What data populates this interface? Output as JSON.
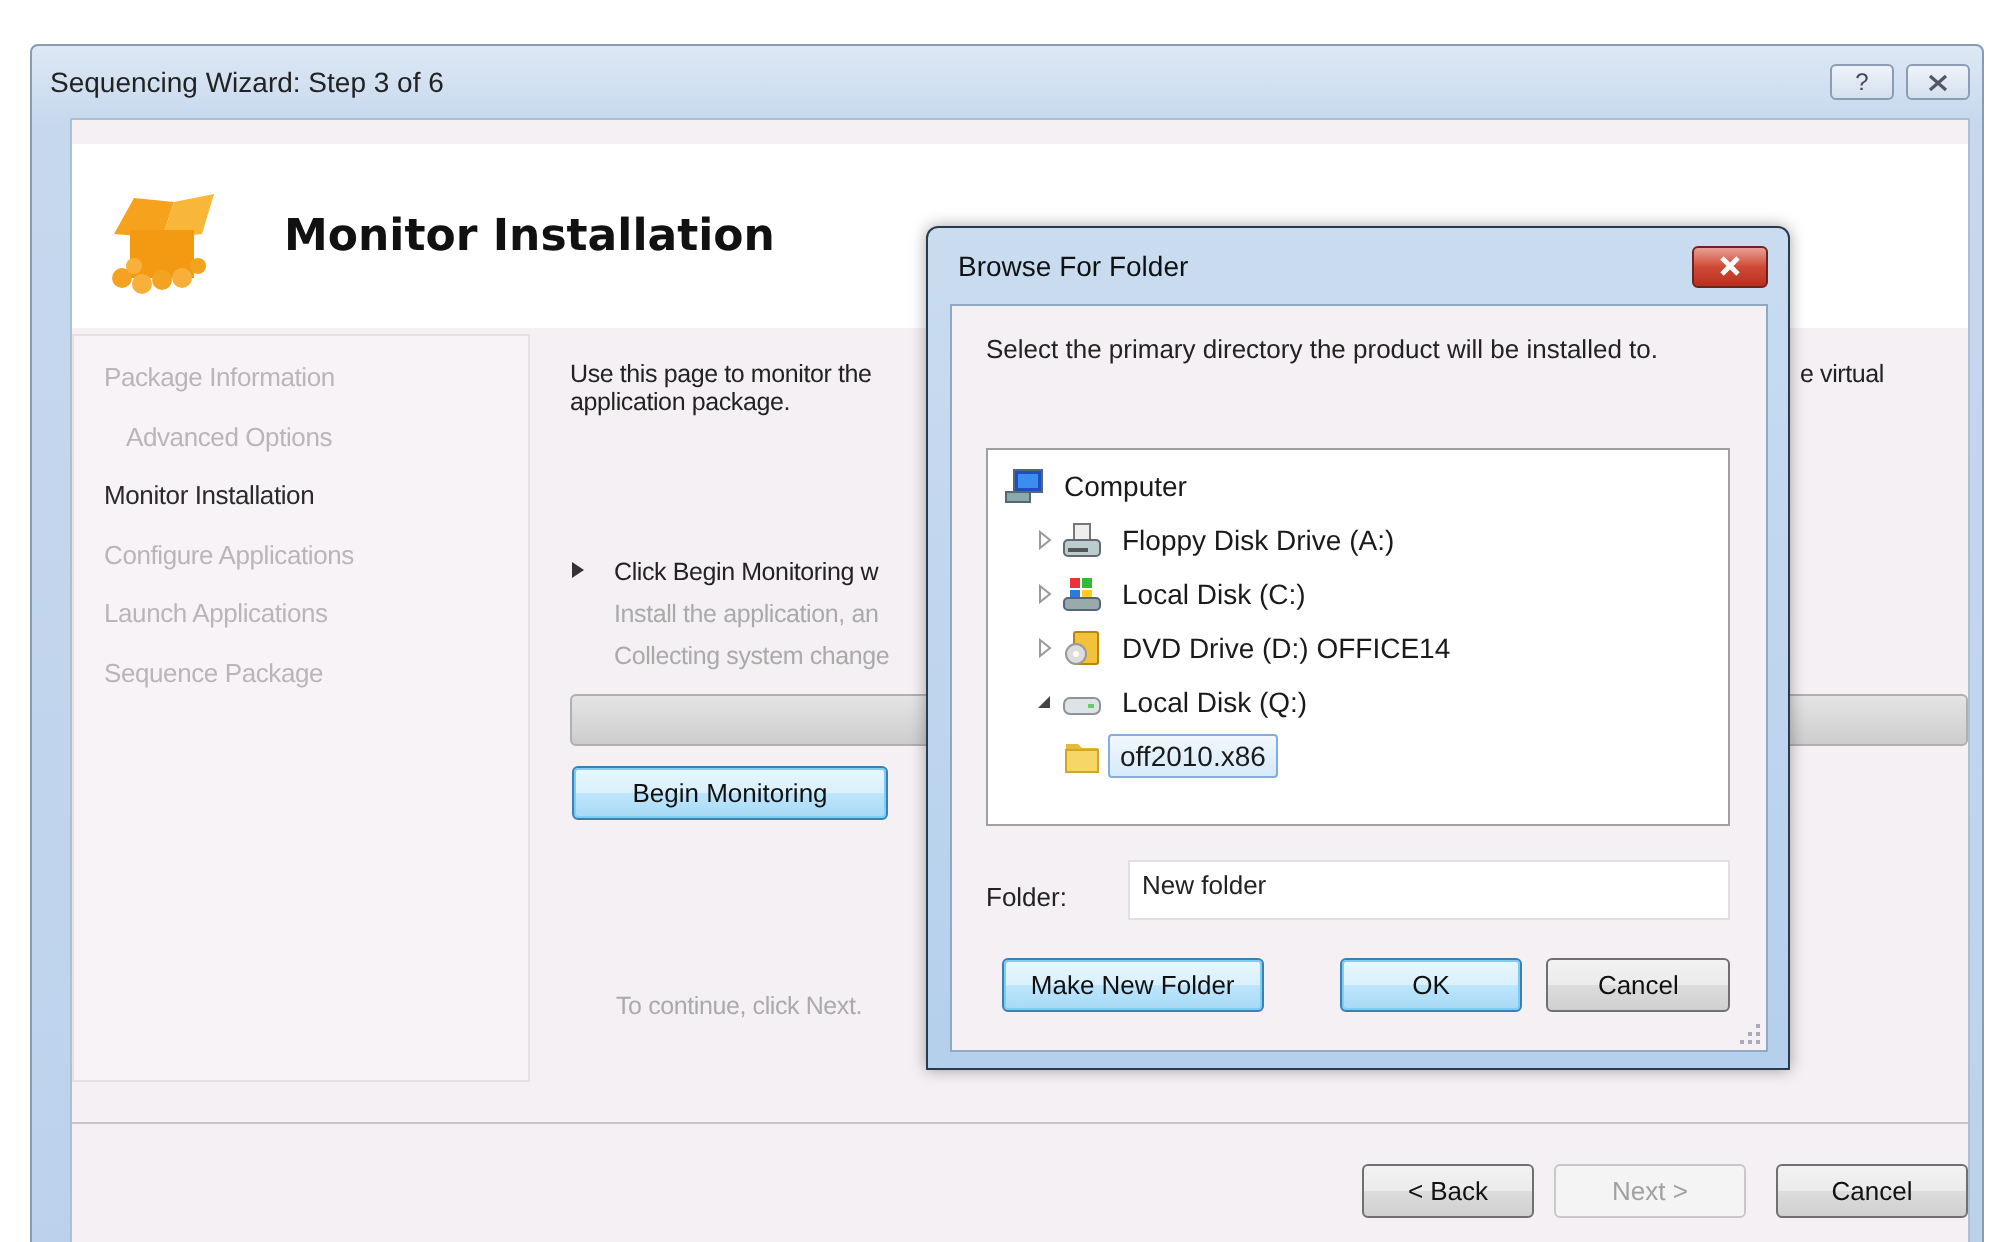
{
  "window": {
    "title": "Sequencing Wizard: Step 3 of 6",
    "help_button": "?"
  },
  "header": {
    "title": "Monitor Installation"
  },
  "sidebar": {
    "items": [
      {
        "label": "Package Information",
        "selected": false,
        "children": [
          {
            "label": "Advanced Options",
            "selected": false
          }
        ]
      },
      {
        "label": "Monitor Installation",
        "selected": true
      },
      {
        "label": "Configure Applications",
        "selected": false
      },
      {
        "label": "Launch Applications",
        "selected": false
      },
      {
        "label": "Sequence Package",
        "selected": false
      }
    ]
  },
  "main": {
    "intro_left": "Use this page to monitor the",
    "intro_right": "e virtual",
    "intro_line2": "application package.",
    "step": {
      "title": "Click Begin Monitoring w",
      "lines": [
        "Install the application, an",
        "Collecting system change"
      ]
    },
    "progress": {
      "level": 0
    },
    "begin_button": {
      "label": "Begin Monitoring",
      "focused": true
    },
    "continue_text": "To continue, click Next."
  },
  "nav_buttons": [
    {
      "label": "< Back",
      "disabled": false
    },
    {
      "label": "Next >",
      "disabled": true
    },
    {
      "label": "Cancel",
      "disabled": false
    }
  ],
  "dialog": {
    "title": "Browse For Folder",
    "prompt": "Select the primary directory the product will be installed to.",
    "tree": [
      {
        "label": "Computer",
        "kind": "computer",
        "selected": false,
        "children": [
          {
            "label": "Floppy Disk Drive (A:)",
            "kind": "floppy",
            "expanded": false,
            "selected": false
          },
          {
            "label": "Local Disk (C:)",
            "kind": "system-disk",
            "expanded": false,
            "selected": false
          },
          {
            "label": "DVD Drive (D:) OFFICE14",
            "kind": "dvd",
            "expanded": false,
            "selected": false
          },
          {
            "label": "Local Disk (Q:)",
            "kind": "disk",
            "expanded": true,
            "selected": false,
            "children": [
              {
                "label": "off2010.x86",
                "kind": "folder",
                "selected": true
              }
            ]
          }
        ]
      }
    ],
    "folder_label": "Folder:",
    "folder_value": "New folder",
    "buttons": [
      {
        "label": "Make New Folder",
        "focused": true
      },
      {
        "label": "OK",
        "focused": true
      },
      {
        "label": "Cancel",
        "focused": false
      }
    ]
  }
}
